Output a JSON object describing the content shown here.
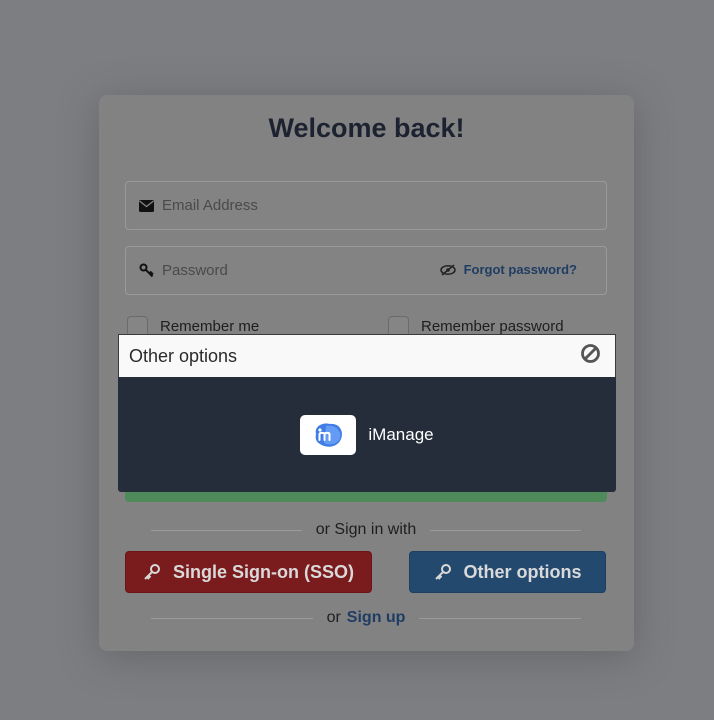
{
  "login": {
    "title": "Welcome back!",
    "email_placeholder": "Email Address",
    "password_placeholder": "Password",
    "forgot_password": "Forgot password?",
    "remember_me": "Remember me",
    "remember_password": "Remember password",
    "or_sign_in_with": "or Sign in with",
    "sso_button": "Single Sign-on (SSO)",
    "other_options_button": "Other options",
    "or": "or",
    "sign_up": "Sign up"
  },
  "popup": {
    "title": "Other options",
    "providers": [
      {
        "name": "iManage",
        "logo_icon": "imanage-logo-icon"
      }
    ]
  },
  "colors": {
    "sso": "#7a1c1e",
    "other": "#24496f",
    "link": "#1f3d63",
    "popup_body": "#252d3b"
  }
}
